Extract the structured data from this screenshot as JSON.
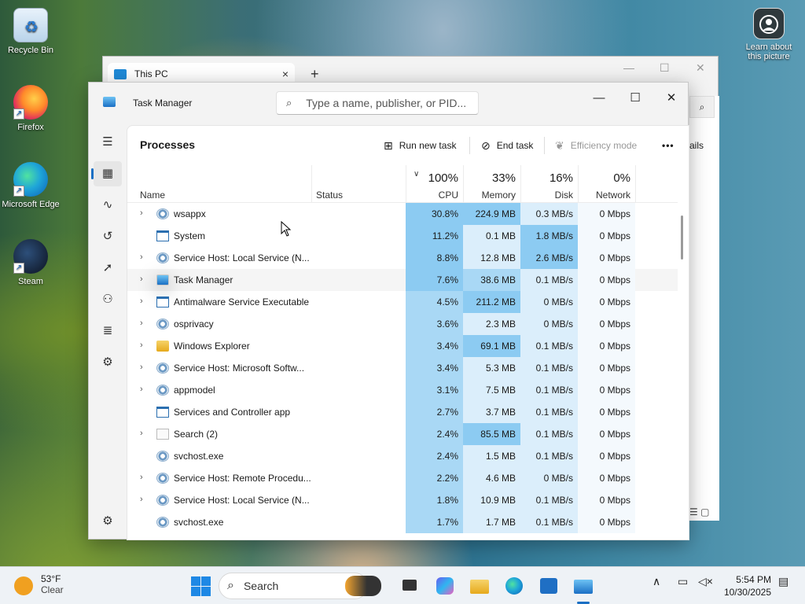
{
  "desktop": {
    "icons": [
      {
        "label": "Recycle Bin"
      },
      {
        "label": "Firefox"
      },
      {
        "label": "Microsoft Edge"
      },
      {
        "label": "Steam"
      }
    ],
    "learn_label": "Learn about this picture"
  },
  "explorer": {
    "tab_title": "This PC",
    "tab_close": "×",
    "new_tab": "+",
    "min": "—",
    "max": "☐",
    "close": "✕",
    "details_partial": "ails"
  },
  "task_manager": {
    "title": "Task Manager",
    "search_placeholder": "Type a name, publisher, or PID...",
    "window_controls": {
      "min": "—",
      "max": "☐",
      "close": "✕"
    },
    "heading": "Processes",
    "toolbar": {
      "run_new_task": "Run new task",
      "end_task": "End task",
      "efficiency_mode": "Efficiency mode",
      "more": "•••"
    },
    "columns": {
      "name": "Name",
      "status": "Status",
      "cpu_pct": "100%",
      "cpu": "CPU",
      "mem_pct": "33%",
      "memory": "Memory",
      "disk_pct": "16%",
      "disk": "Disk",
      "net_pct": "0%",
      "network": "Network"
    },
    "processes": [
      {
        "name": "wsappx",
        "expandable": true,
        "icon": "gear",
        "cpu": "30.8%",
        "mem": "224.9 MB",
        "disk": "0.3 MB/s",
        "net": "0 Mbps"
      },
      {
        "name": "System",
        "expandable": false,
        "icon": "win",
        "cpu": "11.2%",
        "mem": "0.1 MB",
        "disk": "1.8 MB/s",
        "net": "0 Mbps"
      },
      {
        "name": "Service Host: Local Service (N...",
        "expandable": true,
        "icon": "gear",
        "cpu": "8.8%",
        "mem": "12.8 MB",
        "disk": "2.6 MB/s",
        "net": "0 Mbps"
      },
      {
        "name": "Task Manager",
        "expandable": true,
        "icon": "tm",
        "cpu": "7.6%",
        "mem": "38.6 MB",
        "disk": "0.1 MB/s",
        "net": "0 Mbps"
      },
      {
        "name": "Antimalware Service Executable",
        "expandable": true,
        "icon": "win",
        "cpu": "4.5%",
        "mem": "211.2 MB",
        "disk": "0 MB/s",
        "net": "0 Mbps"
      },
      {
        "name": "osprivacy",
        "expandable": true,
        "icon": "gear",
        "cpu": "3.6%",
        "mem": "2.3 MB",
        "disk": "0 MB/s",
        "net": "0 Mbps"
      },
      {
        "name": "Windows Explorer",
        "expandable": true,
        "icon": "folder",
        "cpu": "3.4%",
        "mem": "69.1 MB",
        "disk": "0.1 MB/s",
        "net": "0 Mbps"
      },
      {
        "name": "Service Host: Microsoft Softw...",
        "expandable": true,
        "icon": "gear",
        "cpu": "3.4%",
        "mem": "5.3 MB",
        "disk": "0.1 MB/s",
        "net": "0 Mbps"
      },
      {
        "name": "appmodel",
        "expandable": true,
        "icon": "gear",
        "cpu": "3.1%",
        "mem": "7.5 MB",
        "disk": "0.1 MB/s",
        "net": "0 Mbps"
      },
      {
        "name": "Services and Controller app",
        "expandable": false,
        "icon": "win",
        "cpu": "2.7%",
        "mem": "3.7 MB",
        "disk": "0.1 MB/s",
        "net": "0 Mbps"
      },
      {
        "name": "Search (2)",
        "expandable": true,
        "icon": "blank",
        "cpu": "2.4%",
        "mem": "85.5 MB",
        "disk": "0.1 MB/s",
        "net": "0 Mbps"
      },
      {
        "name": "svchost.exe",
        "expandable": false,
        "icon": "gear",
        "cpu": "2.4%",
        "mem": "1.5 MB",
        "disk": "0.1 MB/s",
        "net": "0 Mbps"
      },
      {
        "name": "Service Host: Remote Procedu...",
        "expandable": true,
        "icon": "gear",
        "cpu": "2.2%",
        "mem": "4.6 MB",
        "disk": "0 MB/s",
        "net": "0 Mbps"
      },
      {
        "name": "Service Host: Local Service (N...",
        "expandable": true,
        "icon": "gear",
        "cpu": "1.8%",
        "mem": "10.9 MB",
        "disk": "0.1 MB/s",
        "net": "0 Mbps"
      },
      {
        "name": "svchost.exe",
        "expandable": false,
        "icon": "gear",
        "cpu": "1.7%",
        "mem": "1.7 MB",
        "disk": "0.1 MB/s",
        "net": "0 Mbps"
      }
    ]
  },
  "taskbar": {
    "temperature": "53°F",
    "condition": "Clear",
    "search_label": "Search",
    "time": "5:54 PM",
    "date": "10/30/2025"
  }
}
